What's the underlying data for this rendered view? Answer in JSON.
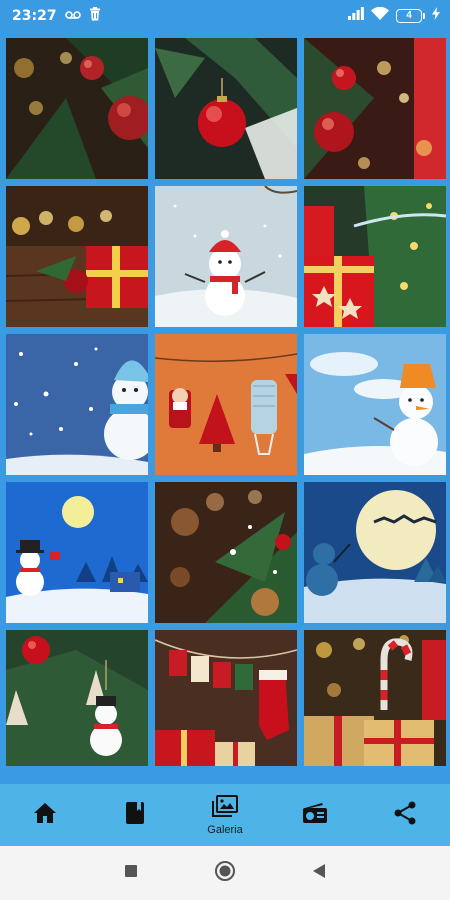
{
  "status_bar": {
    "time": "23:27",
    "battery_level": "4",
    "icons": [
      "voicemail-icon",
      "trash-icon",
      "signal-icon",
      "wifi-icon",
      "battery-icon",
      "charging-bolt-icon"
    ]
  },
  "gallery": {
    "images": [
      {
        "subject": "christmas-tree-red-ornament-bokeh"
      },
      {
        "subject": "red-bauble-pine-branch"
      },
      {
        "subject": "red-bauble-fairy-lights"
      },
      {
        "subject": "red-gift-box-wooden-table"
      },
      {
        "subject": "snowman-cartoon-snow"
      },
      {
        "subject": "red-gift-boxes-christmas-tree"
      },
      {
        "subject": "snowman-blue-hat-snowfall"
      },
      {
        "subject": "santa-tree-face-mask-on-line"
      },
      {
        "subject": "snowman-orange-bucket-sky"
      },
      {
        "subject": "snowman-moon-night-village"
      },
      {
        "subject": "pine-branch-ornaments-bokeh"
      },
      {
        "subject": "santa-sleigh-moon-snowman"
      },
      {
        "subject": "snowman-ornament-tree"
      },
      {
        "subject": "advent-stockings-gifts"
      },
      {
        "subject": "candy-cane-gifts-lights"
      }
    ]
  },
  "bottom_nav": {
    "items": [
      {
        "icon": "home-icon",
        "label": ""
      },
      {
        "icon": "book-icon",
        "label": ""
      },
      {
        "icon": "gallery-icon",
        "label": "Galeria"
      },
      {
        "icon": "radio-icon",
        "label": ""
      },
      {
        "icon": "share-icon",
        "label": ""
      }
    ]
  },
  "system_nav": {
    "buttons": [
      "recents-square-icon",
      "home-circle-icon",
      "back-triangle-icon"
    ]
  },
  "colors": {
    "status_bar": "#3a9be3",
    "grid_background": "#3a9be3",
    "bottom_nav": "#4eb4e8",
    "system_nav": "#f4f4f4"
  }
}
